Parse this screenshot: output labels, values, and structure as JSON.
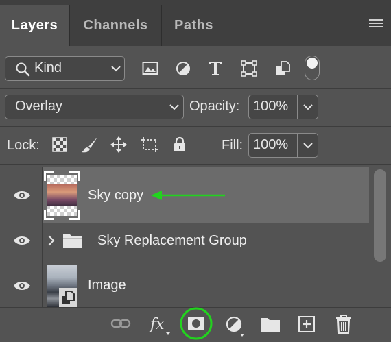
{
  "tabs": [
    {
      "label": "Layers",
      "active": true
    },
    {
      "label": "Channels",
      "active": false
    },
    {
      "label": "Paths",
      "active": false
    }
  ],
  "filter": {
    "kind_label": "Kind",
    "filter_icons": [
      "image-filter-icon",
      "adjustment-filter-icon",
      "type-filter-icon",
      "shape-filter-icon",
      "smart-object-filter-icon",
      "filter-toggle-icon"
    ]
  },
  "blend": {
    "mode": "Overlay",
    "opacity_label": "Opacity:",
    "opacity_value": "100%"
  },
  "lock": {
    "label": "Lock:",
    "icons": [
      "lock-transparent-pixels-icon",
      "lock-image-pixels-icon",
      "lock-position-icon",
      "lock-artboard-icon",
      "lock-all-icon"
    ],
    "fill_label": "Fill:",
    "fill_value": "100%"
  },
  "layers": [
    {
      "name": "Sky copy",
      "visible": true,
      "selected": true,
      "type": "pixel"
    },
    {
      "name": "Sky Replacement Group",
      "visible": true,
      "selected": false,
      "type": "group"
    },
    {
      "name": "Image",
      "visible": true,
      "selected": false,
      "type": "smart-object"
    }
  ],
  "bottom_icons": [
    "link-layers-icon",
    "layer-style-fx-icon",
    "add-mask-icon",
    "adjustment-layer-icon",
    "new-group-icon",
    "new-layer-icon",
    "delete-layer-icon"
  ],
  "colors": {
    "panel": "#535353",
    "selected_row": "#707070",
    "annotation_arrow": "#22d31e",
    "annotation_circle": "#22d31e"
  }
}
